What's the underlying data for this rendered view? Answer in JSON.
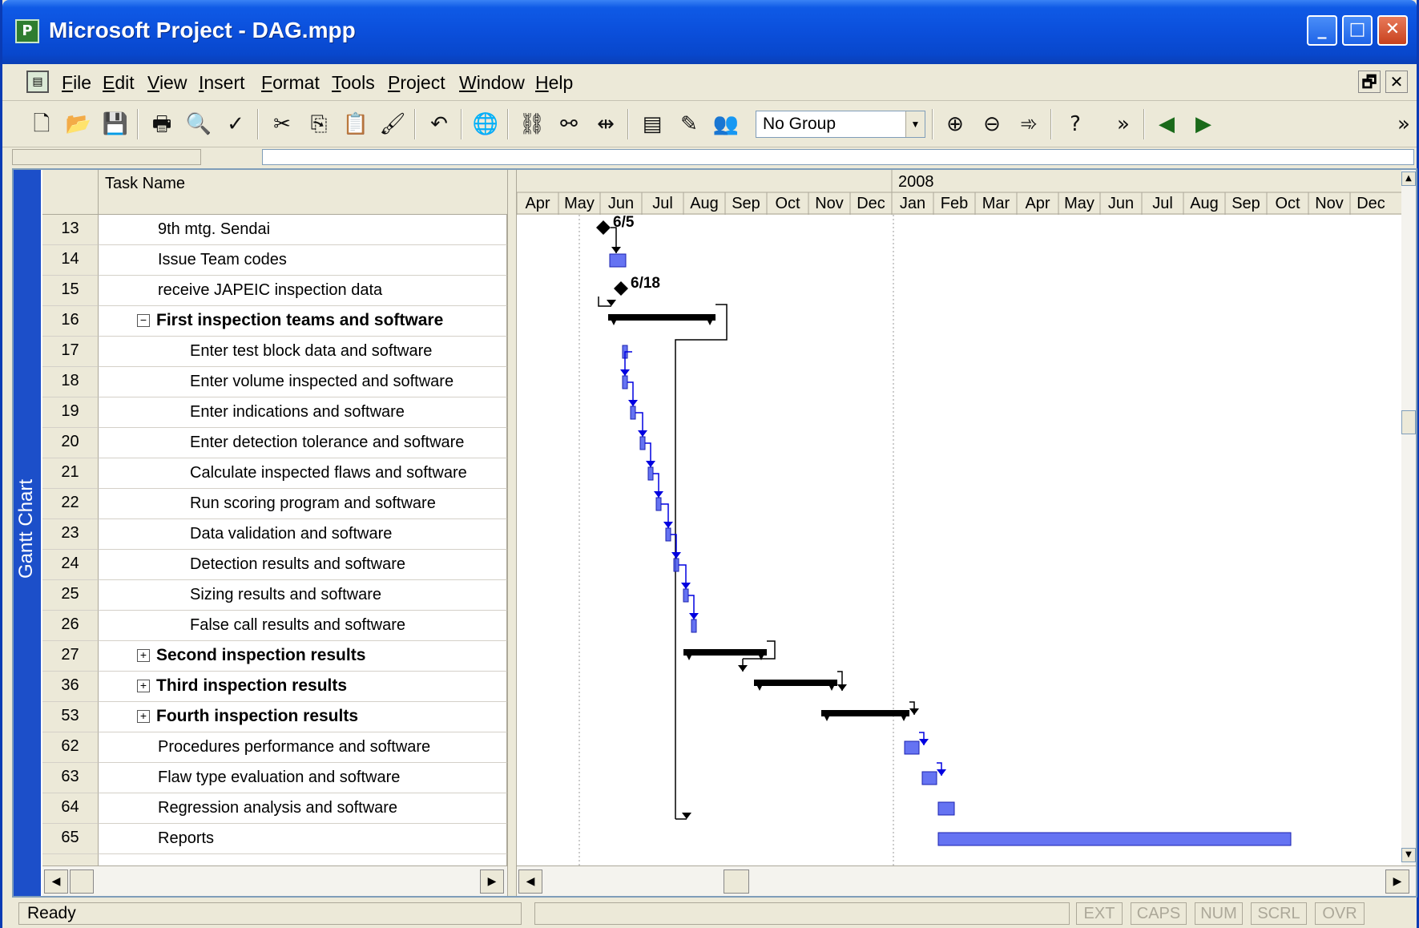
{
  "window": {
    "title": "Microsoft Project - DAG.mpp",
    "controls": {
      "minimize": "_",
      "maximize": "□",
      "close": "✕"
    }
  },
  "menu": {
    "items": [
      "File",
      "Edit",
      "View",
      "Insert",
      "Format",
      "Tools",
      "Project",
      "Window",
      "Help"
    ],
    "restore": "🗗",
    "close": "✕"
  },
  "toolbar": {
    "group_select": "No Group",
    "buttons": [
      "new-icon",
      "open-icon",
      "save-icon",
      "print-icon",
      "print-preview-icon",
      "spelling-icon",
      "cut-icon",
      "copy-icon",
      "paste-icon",
      "format-painter-icon",
      "undo-icon",
      "hyperlink-icon",
      "link-tasks-icon",
      "unlink-tasks-icon",
      "split-task-icon",
      "task-info-icon",
      "task-notes-icon",
      "assign-resources-icon",
      "zoom-in-icon",
      "zoom-out-icon",
      "goto-task-icon",
      "help-icon",
      "more-buttons-icon",
      "scroll-left-icon",
      "scroll-right-icon"
    ]
  },
  "view_bar": {
    "label": "Gantt Chart"
  },
  "table": {
    "header": {
      "task_name": "Task Name"
    },
    "rows": [
      {
        "id": "13",
        "name": "9th mtg. Sendai",
        "level": 1,
        "summary": false
      },
      {
        "id": "14",
        "name": "Issue Team codes",
        "level": 1,
        "summary": false
      },
      {
        "id": "15",
        "name": "receive JAPEIC inspection data",
        "level": 1,
        "summary": false
      },
      {
        "id": "16",
        "name": "First inspection teams and software",
        "level": 1,
        "summary": true,
        "expander": "−"
      },
      {
        "id": "17",
        "name": "Enter test block data and software",
        "level": 2,
        "summary": false
      },
      {
        "id": "18",
        "name": "Enter volume inspected and software",
        "level": 2,
        "summary": false
      },
      {
        "id": "19",
        "name": "Enter indications and software",
        "level": 2,
        "summary": false
      },
      {
        "id": "20",
        "name": "Enter detection tolerance and software",
        "level": 2,
        "summary": false
      },
      {
        "id": "21",
        "name": "Calculate inspected flaws and software",
        "level": 2,
        "summary": false
      },
      {
        "id": "22",
        "name": "Run scoring program and software",
        "level": 2,
        "summary": false
      },
      {
        "id": "23",
        "name": "Data validation and software",
        "level": 2,
        "summary": false
      },
      {
        "id": "24",
        "name": "Detection results and software",
        "level": 2,
        "summary": false
      },
      {
        "id": "25",
        "name": "Sizing results and software",
        "level": 2,
        "summary": false
      },
      {
        "id": "26",
        "name": "False call results and software",
        "level": 2,
        "summary": false
      },
      {
        "id": "27",
        "name": "Second inspection results",
        "level": 1,
        "summary": true,
        "expander": "+"
      },
      {
        "id": "36",
        "name": "Third inspection results",
        "level": 1,
        "summary": true,
        "expander": "+"
      },
      {
        "id": "53",
        "name": "Fourth inspection results",
        "level": 1,
        "summary": true,
        "expander": "+"
      },
      {
        "id": "62",
        "name": "Procedures performance and software",
        "level": 1,
        "summary": false
      },
      {
        "id": "63",
        "name": "Flaw type evaluation and software",
        "level": 1,
        "summary": false
      },
      {
        "id": "64",
        "name": "Regression analysis and software",
        "level": 1,
        "summary": false
      },
      {
        "id": "65",
        "name": "Reports",
        "level": 1,
        "summary": false
      }
    ]
  },
  "timescale": {
    "year_label": "2008",
    "months": [
      "Apr",
      "May",
      "Jun",
      "Jul",
      "Aug",
      "Sep",
      "Oct",
      "Nov",
      "Dec",
      "Jan",
      "Feb",
      "Mar",
      "Apr",
      "May",
      "Jun",
      "Jul",
      "Aug",
      "Sep",
      "Oct",
      "Nov",
      "Dec"
    ]
  },
  "milestones": [
    {
      "row": "13",
      "label": "6/5"
    },
    {
      "row": "15",
      "label": "6/18"
    }
  ],
  "status": {
    "text": "Ready",
    "indicators": [
      "EXT",
      "CAPS",
      "NUM",
      "SCRL",
      "OVR"
    ]
  },
  "colors": {
    "task_bar": "#4a5af0",
    "summary_bar": "#000000",
    "link": "#0000e0",
    "title_bar": "#0b4fdb"
  }
}
